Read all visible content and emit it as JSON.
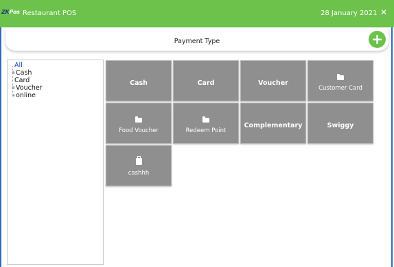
{
  "titlebar": {
    "logo_prefix": "ZK",
    "logo_suffix": "Pos",
    "app_title": "Restaurant POS",
    "date": "28 January 2021",
    "close_glyph": "✕"
  },
  "header": {
    "title": "Payment Type",
    "add_glyph": "+"
  },
  "tree": {
    "items": [
      {
        "label": "All"
      },
      {
        "label": "Cash"
      },
      {
        "label": "Card"
      },
      {
        "label": "Voucher"
      },
      {
        "label": "online"
      }
    ],
    "expander_glyph": "⊕"
  },
  "tiles": [
    {
      "label": "Cash",
      "icon": "none"
    },
    {
      "label": "Card",
      "icon": "none"
    },
    {
      "label": "Voucher",
      "icon": "none"
    },
    {
      "label": "Customer Card",
      "icon": "folder-icon"
    },
    {
      "label": "Food Voucher",
      "icon": "folder-icon"
    },
    {
      "label": "Redeem Point",
      "icon": "folder-icon"
    },
    {
      "label": "Complementary",
      "icon": "none"
    },
    {
      "label": "Swiggy",
      "icon": "none"
    },
    {
      "label": "cashhh",
      "icon": "wallet-icon"
    }
  ],
  "colors": {
    "accent_green": "#6cc24a",
    "tile_gray": "#8f8f8f",
    "frame_blue": "#2d6bb8",
    "tree_selected": "#1a3fb0"
  }
}
